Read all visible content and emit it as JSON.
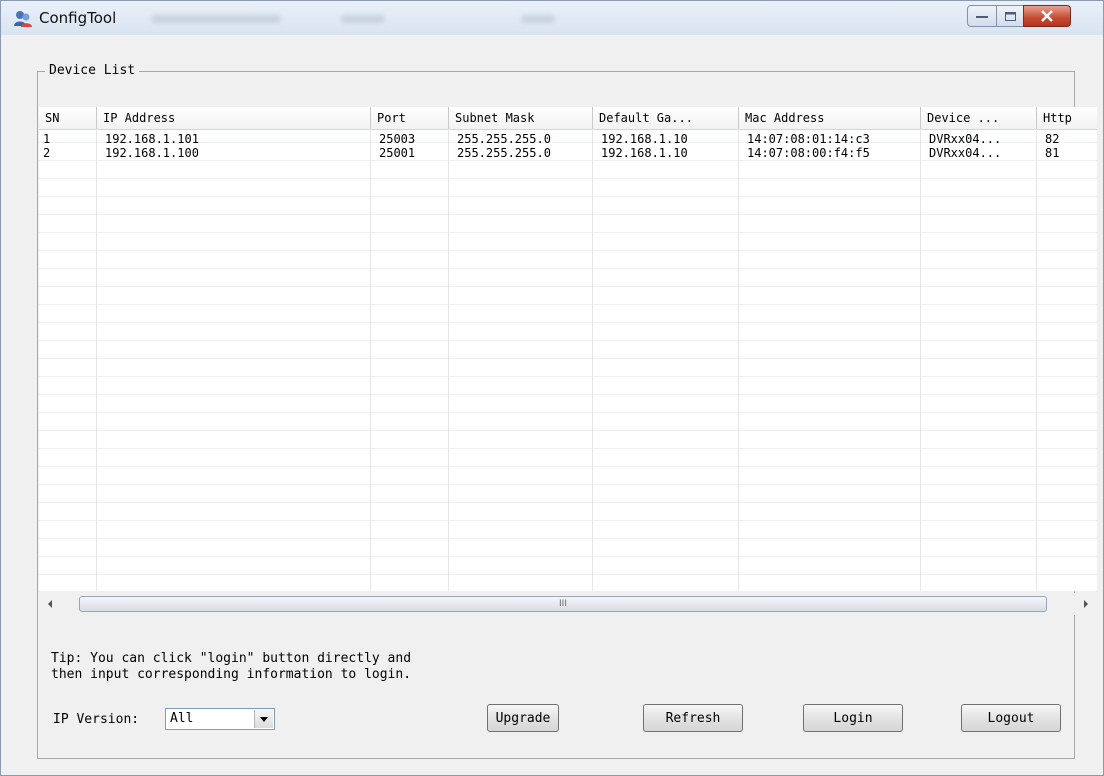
{
  "window": {
    "title": "ConfigTool",
    "minimize_icon": "minimize-icon",
    "maximize_icon": "maximize-icon",
    "close_icon": "close-icon"
  },
  "device_list": {
    "group_label": "Device List",
    "columns": [
      "SN",
      "IP Address",
      "Port",
      "Subnet Mask",
      "Default Ga...",
      "Mac Address",
      "Device ...",
      "Http"
    ],
    "rows": [
      [
        "1",
        "192.168.1.101",
        "25003",
        "255.255.255.0",
        "192.168.1.10",
        "14:07:08:01:14:c3",
        "DVRxx04...",
        "82"
      ],
      [
        "2",
        "192.168.1.100",
        "25001",
        "255.255.255.0",
        "192.168.1.10",
        "14:07:08:00:f4:f5",
        "DVRxx04...",
        "81"
      ]
    ]
  },
  "scrollbar": {
    "thumb_grip": "III"
  },
  "tip": "Tip: You can click \"login\" button directly and\nthen input corresponding information to login.",
  "ip_version": {
    "label": "IP Version:",
    "value": "All"
  },
  "buttons": {
    "upgrade": "Upgrade",
    "refresh": "Refresh",
    "login": "Login",
    "logout": "Logout"
  }
}
